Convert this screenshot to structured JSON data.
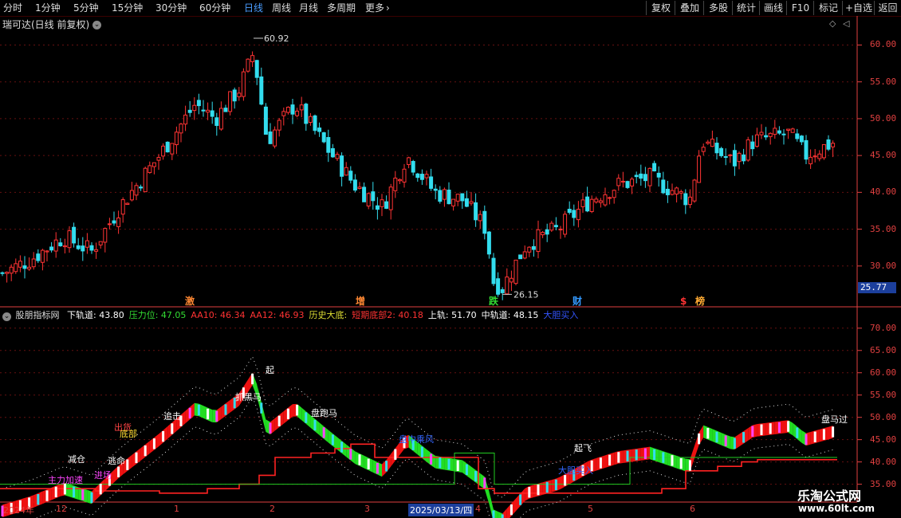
{
  "toolbar": {
    "periods": [
      "分时",
      "1分钟",
      "5分钟",
      "15分钟",
      "30分钟",
      "60分钟",
      "日线",
      "周线",
      "月线",
      "多周期",
      "更多"
    ],
    "active": "日线",
    "right_buttons": [
      "复权",
      "叠加",
      "多股",
      "统计",
      "画线",
      "F10",
      "+自选",
      "返回"
    ],
    "mark_label": "标记"
  },
  "main_chart": {
    "title": "瑞可达(日线 前复权)",
    "high_label": "60.92",
    "low_label": "26.15",
    "last_price": "25.77",
    "y_ticks": [
      "60.00",
      "55.00",
      "50.00",
      "45.00",
      "40.00",
      "35.00",
      "30.00"
    ],
    "event_marks": [
      "激",
      "增",
      "跌",
      "财",
      "$",
      "榜"
    ]
  },
  "indicator": {
    "name": "股朋指标网",
    "items": [
      {
        "text": "下轨道: 43.80",
        "color": "#ffffff"
      },
      {
        "text": "压力位: 47.05",
        "color": "#33dd33"
      },
      {
        "text": "AA10: 46.34",
        "color": "#ff3333"
      },
      {
        "text": "AA12: 46.93",
        "color": "#ff3333"
      },
      {
        "text": "历史大底:",
        "color": "#dddd33"
      },
      {
        "text": "短期底部2: 40.18",
        "color": "#ff3333"
      },
      {
        "text": "上轨: 51.70",
        "color": "#ffffff"
      },
      {
        "text": "中轨道: 48.15",
        "color": "#ffffff"
      },
      {
        "text": "大胆买入",
        "color": "#3355ff"
      }
    ],
    "y_ticks": [
      "70.00",
      "65.00",
      "60.00",
      "55.00",
      "50.00",
      "45.00",
      "40.00",
      "35.00"
    ],
    "signals": [
      "减仓",
      "逃命",
      "出货",
      "底部",
      "进场",
      "追击",
      "起",
      "抓黑马",
      "主力加速",
      "盘中乘风",
      "盘跑马",
      "大胆买入",
      "起飞",
      "盘马过"
    ]
  },
  "x_axis": {
    "labels": [
      "2024年",
      "12",
      "1",
      "2",
      "3",
      "2025/03/13/四",
      "4",
      "5",
      "6"
    ],
    "highlight": "2025/03/13/四"
  },
  "watermark": {
    "site": "乐淘公式网",
    "url": "www.60lt.com"
  },
  "colors": {
    "up": "#ff3333",
    "down": "#33ddee",
    "bg": "#000000",
    "axis": "#e04040",
    "grid": "#661111"
  }
}
